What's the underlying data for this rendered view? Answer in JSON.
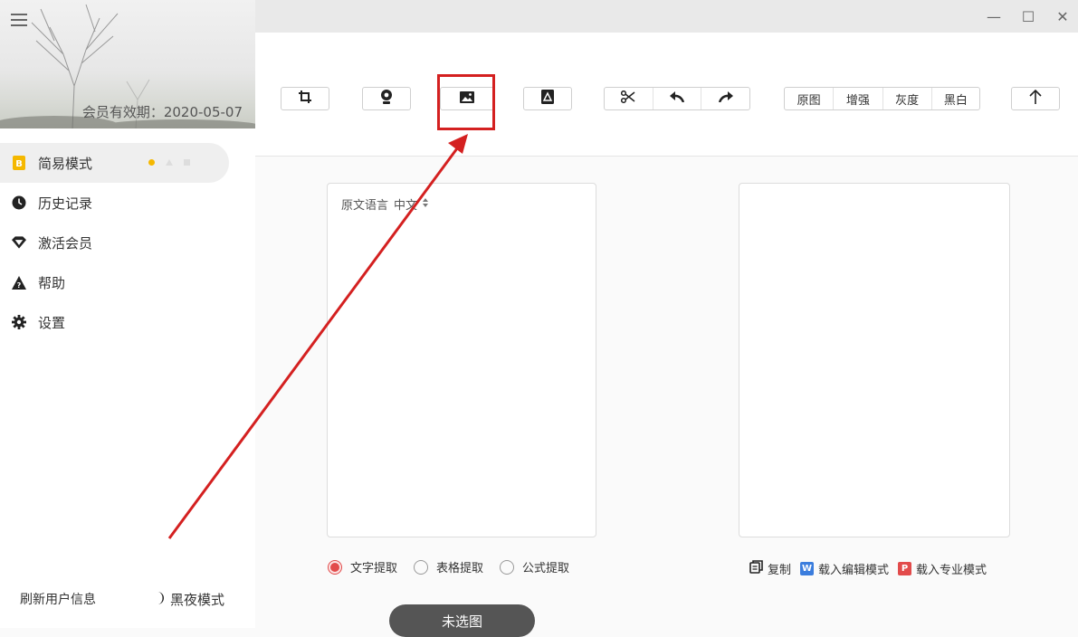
{
  "sidebar": {
    "member_expiry": "会员有效期：2020-05-07",
    "nav": [
      {
        "label": "简易模式",
        "icon": "simple-mode-icon"
      },
      {
        "label": "历史记录",
        "icon": "history-clock-icon"
      },
      {
        "label": "激活会员",
        "icon": "diamond-icon"
      },
      {
        "label": "帮助",
        "icon": "help-warning-icon"
      },
      {
        "label": "设置",
        "icon": "gear-icon"
      }
    ],
    "footer": {
      "refresh_label": "刷新用户信息",
      "night_label": "黑夜模式"
    }
  },
  "window": {
    "minimize_glyph": "—",
    "maximize_glyph": "☐",
    "close_glyph": "✕"
  },
  "toolbar": {
    "tools": [
      "crop-icon",
      "camera-icon",
      "image-icon",
      "pdf-icon",
      "scissors-icon",
      "undo-icon",
      "redo-icon",
      "upload-arrow-icon"
    ],
    "filters": [
      "原图",
      "增强",
      "灰度",
      "黑白"
    ]
  },
  "source_panel": {
    "language_label": "原文语言",
    "language_value": "中文"
  },
  "modes": [
    "文字提取",
    "表格提取",
    "公式提取"
  ],
  "selected_mode": "文字提取",
  "result_actions": {
    "copy": "复制",
    "load_edit": "载入编辑模式",
    "load_pro": "载入专业模式"
  },
  "unselected_button": "未选图",
  "colors": {
    "accent_red": "#e24b4b",
    "annotation_red": "#d42020",
    "word_blue": "#3b7ddd",
    "yellow_dot": "#f5b800"
  }
}
